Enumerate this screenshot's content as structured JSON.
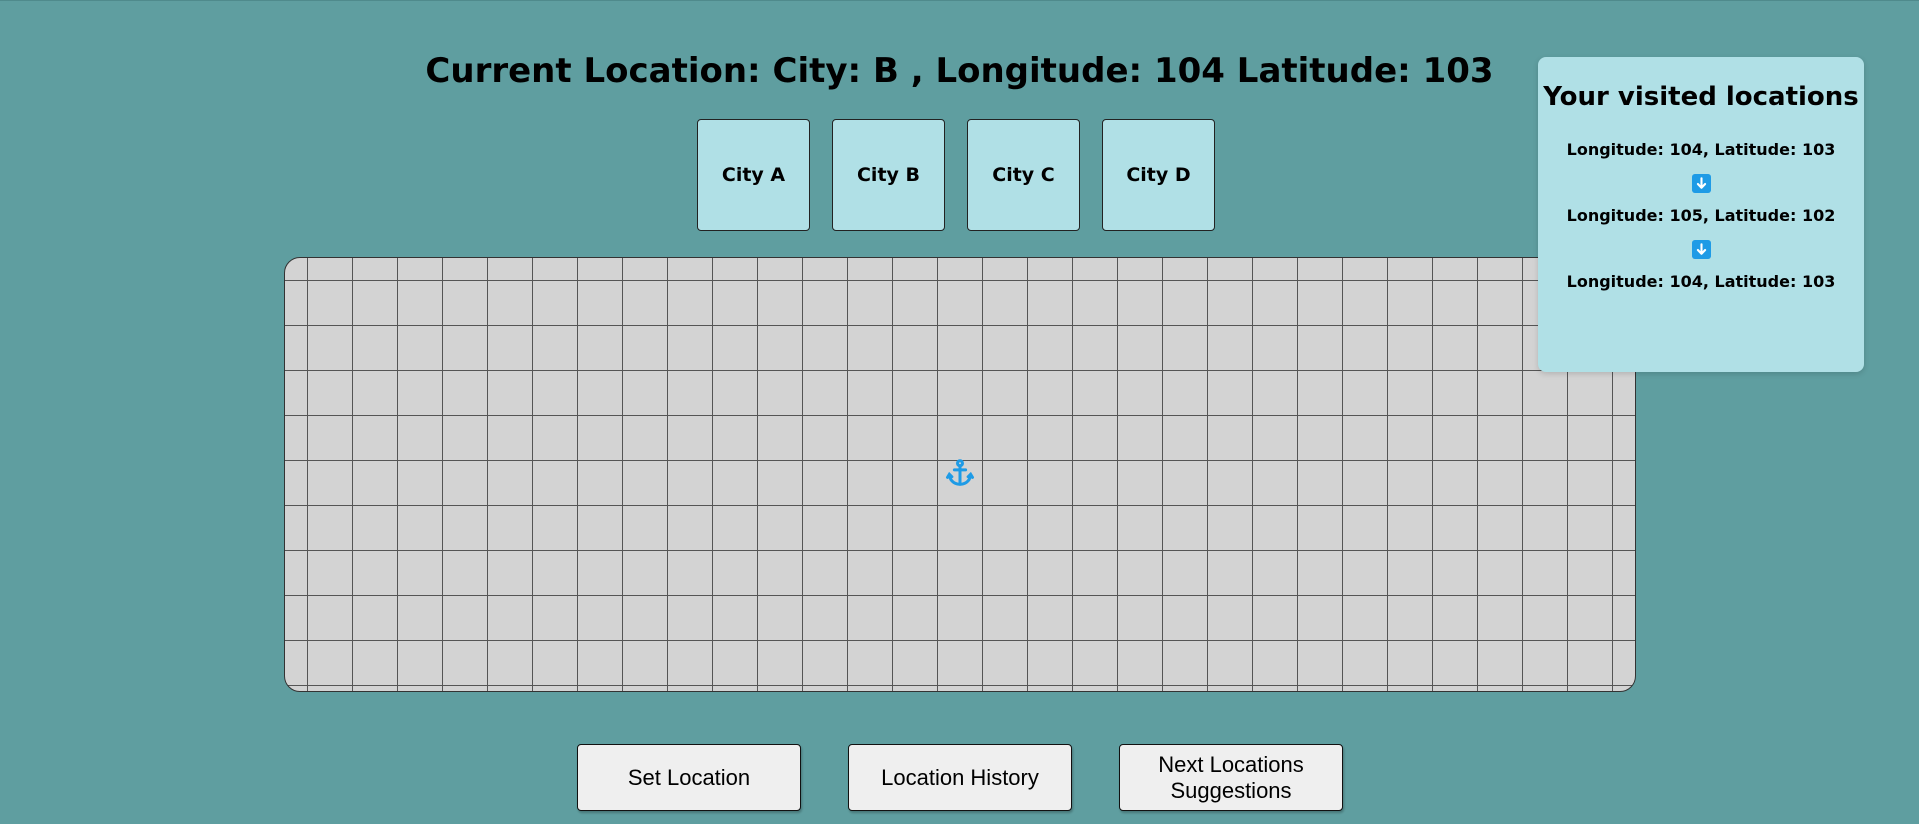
{
  "header": {
    "title": "Current Location: City: B , Longitude: 104 Latitude: 103"
  },
  "cities": [
    {
      "label": "City A"
    },
    {
      "label": "City B"
    },
    {
      "label": "City C"
    },
    {
      "label": "City D"
    }
  ],
  "map": {
    "marker_icon": "anchor-icon",
    "marker_color": "#1e9be6",
    "background_color": "#d3d3d3",
    "grid_line_color": "#555555"
  },
  "history": {
    "title": "Your visited locations",
    "arrow_icon": "arrow-down-icon",
    "arrow_color": "#1e9be6",
    "entries": [
      {
        "text": "Longitude: 104, Latitude: 103"
      },
      {
        "text": "Longitude: 105, Latitude: 102"
      },
      {
        "text": "Longitude: 104, Latitude: 103"
      }
    ]
  },
  "actions": {
    "set_location": "Set Location",
    "location_history": "Location History",
    "next_suggestions": "Next Locations Suggestions"
  },
  "colors": {
    "page_background": "#5f9ea0",
    "panel_background": "#b0e0e6",
    "button_background": "#efefef"
  }
}
